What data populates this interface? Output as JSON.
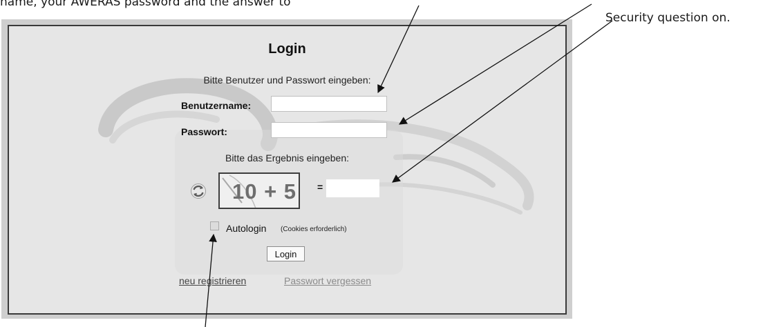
{
  "annotations": {
    "top_caption": "name, your AWERAS password and the answer to",
    "right_caption": "Security question on."
  },
  "login_form": {
    "title": "Login",
    "intro": "Bitte Benutzer und Passwort eingeben:",
    "username_label": "Benutzername:",
    "username_value": "",
    "password_label": "Passwort:",
    "password_value": "",
    "result_prompt": "Bitte das Ergebnis eingeben:",
    "captcha_text": "10 + 5",
    "equals_sign": "=",
    "captcha_answer_value": "",
    "autologin_label": "Autologin",
    "autologin_note": "(Cookies erforderlich)",
    "autologin_checked": false,
    "login_button": "Login",
    "register_link": "neu registrieren",
    "forgot_link": "Passwort vergessen"
  },
  "icons": {
    "refresh": "refresh-icon",
    "arrow": "arrow-icon"
  },
  "colors": {
    "panel_outer": "#cfcfcf",
    "panel_inner": "#e6e6e6",
    "border": "#3a3a3a",
    "text": "#111111",
    "link_muted": "#8a8a8a"
  }
}
